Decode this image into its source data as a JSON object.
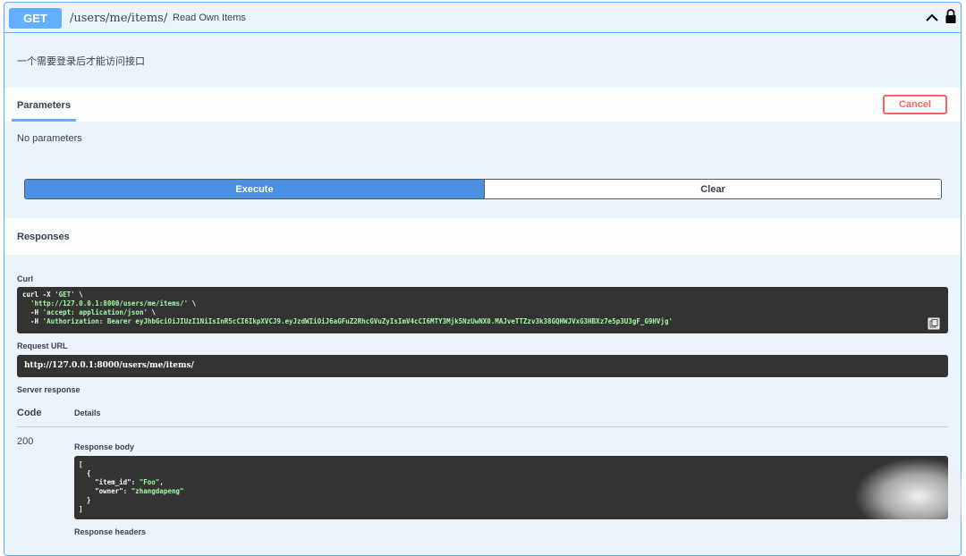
{
  "operation": {
    "method": "GET",
    "path": "/users/me/items/",
    "summary": "Read Own Items",
    "description": "一个需要登录后才能访问接口"
  },
  "parameters": {
    "tab_label": "Parameters",
    "cancel_label": "Cancel",
    "empty_text": "No parameters"
  },
  "actions": {
    "execute_label": "Execute",
    "clear_label": "Clear"
  },
  "responses": {
    "title": "Responses",
    "curl_label": "Curl",
    "curl_lines": [
      {
        "prefix": "curl -X ",
        "str": "'GET'",
        "suffix": " \\"
      },
      {
        "prefix": "  ",
        "str": "'http://127.0.0.1:8000/users/me/items/'",
        "suffix": " \\"
      },
      {
        "prefix": "  -H ",
        "str": "'accept: application/json'",
        "suffix": " \\"
      },
      {
        "prefix": "  -H ",
        "str": "'Authorization: Bearer eyJhbGciOiJIUzI1NiIsInR5cCI6IkpXVCJ9.eyJzdWIiOiJ6aGFuZ2RhcGVuZyIsImV4cCI6MTY3Mjk5NzUwNX0.MAJveTTZzv3k38GQHWJVxG3HBXz7e5p3U3gF_G9HVjg'",
        "suffix": ""
      }
    ],
    "request_url_label": "Request URL",
    "request_url": "http://127.0.0.1:8000/users/me/items/",
    "server_response_label": "Server response",
    "col_code": "Code",
    "col_details": "Details",
    "status_code": "200",
    "response_body_label": "Response body",
    "response_body": {
      "open_bracket": "[",
      "open_brace": "{",
      "fields": [
        {
          "key": "\"item_id\"",
          "value": "\"Foo\"",
          "comma": ","
        },
        {
          "key": "\"owner\"",
          "value": "\"zhangdapeng\"",
          "comma": ""
        }
      ],
      "close_brace": "}",
      "close_bracket": "]"
    },
    "response_headers_label": "Response headers"
  },
  "colors": {
    "get_accent": "#61affe",
    "execute_bg": "#4990e2",
    "cancel": "#ff6060",
    "code_bg": "#333333",
    "string": "#a2fca2"
  },
  "icons": [
    "chevron-up-icon",
    "lock-icon",
    "copy-icon"
  ]
}
